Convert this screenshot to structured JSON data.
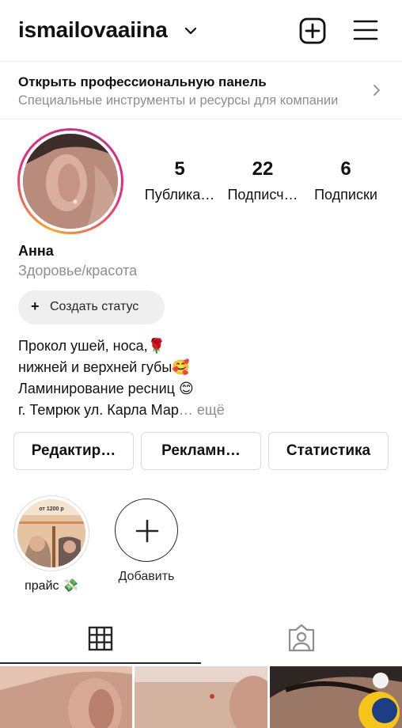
{
  "header": {
    "username": "ismailovaaiina",
    "add_icon": "plus-square-icon",
    "menu_icon": "hamburger-menu-icon"
  },
  "pro_panel": {
    "title": "Открыть профессиональную панель",
    "subtitle": "Специальные инструменты и ресурсы для компании"
  },
  "stats": [
    {
      "value": "5",
      "label": "Публика…"
    },
    {
      "value": "22",
      "label": "Подписч…"
    },
    {
      "value": "6",
      "label": "Подписки"
    }
  ],
  "profile": {
    "name": "Анна",
    "category": "Здоровье/красота",
    "status_button": "Создать статус",
    "bio_lines": [
      "Прокол ушей, носа,🌹",
      "нижней и верхней губы🥰",
      "Ламинирование ресниц 😊",
      "г. Темрюк ул. Карла Мар"
    ],
    "more": "… ещё"
  },
  "actions": [
    "Редактир…",
    "Рекламн…",
    "Статистика"
  ],
  "highlights": [
    {
      "label": "прайс 💸",
      "thumb_text": "от 1200 р"
    },
    {
      "label": "Добавить"
    }
  ],
  "tabs": [
    {
      "name": "grid",
      "icon": "grid-icon",
      "active": true
    },
    {
      "name": "tagged",
      "icon": "tagged-person-icon",
      "active": false
    }
  ],
  "colors": {
    "text": "#262626",
    "secondary": "#8e8e8e",
    "border": "#dbdbdb",
    "chip": "#efefef"
  }
}
